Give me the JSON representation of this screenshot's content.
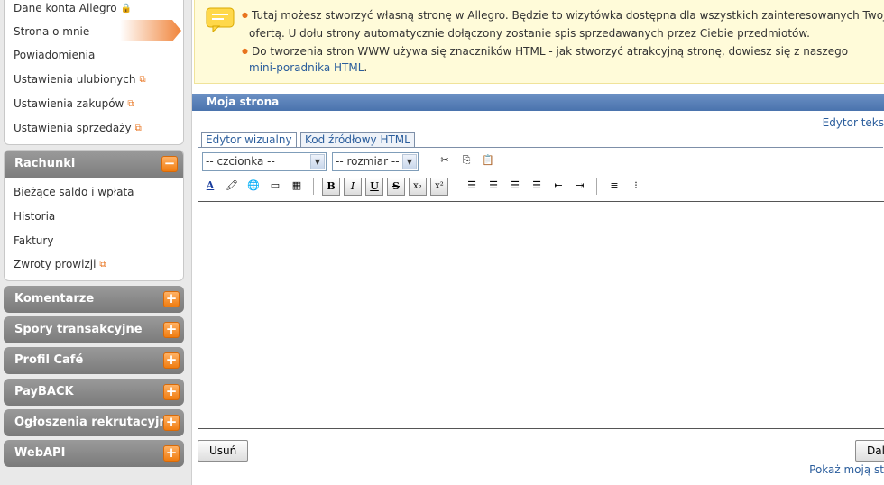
{
  "sidebar": {
    "account_items": [
      {
        "label": "Dane konta Allegro",
        "icon": "lock-icon"
      },
      {
        "label": "Strona o mnie",
        "active": true
      },
      {
        "label": "Powiadomienia"
      },
      {
        "label": "Ustawienia ulubionych",
        "icon": "external-link-icon"
      },
      {
        "label": "Ustawienia zakupów",
        "icon": "external-link-icon"
      },
      {
        "label": "Ustawienia sprzedaży",
        "icon": "external-link-icon"
      }
    ],
    "rachunki": {
      "title": "Rachunki",
      "toggle": "−",
      "items": [
        {
          "label": "Bieżące saldo i wpłata"
        },
        {
          "label": "Historia"
        },
        {
          "label": "Faktury"
        },
        {
          "label": "Zwroty prowizji",
          "icon": "external-link-icon"
        }
      ]
    },
    "collapsed": [
      {
        "title": "Komentarze",
        "toggle": "+"
      },
      {
        "title": "Spory transakcyjne",
        "toggle": "+"
      },
      {
        "title": "Profil Café",
        "toggle": "+"
      },
      {
        "title": "PayBACK",
        "toggle": "+"
      },
      {
        "title": "Ogłoszenia rekrutacyjne",
        "toggle": "+"
      },
      {
        "title": "WebAPI",
        "toggle": "+"
      }
    ]
  },
  "info": {
    "line1": "Tutaj możesz stworzyć własną stronę w Allegro. Będzie to wizytówka dostępna dla wszystkich zainteresowanych Twoją",
    "line2": "ofertą. U dołu strony automatycznie dołączony zostanie spis sprzedawanych przez Ciebie przedmiotów.",
    "line3": "Do tworzenia stron WWW używa się znaczników HTML - jak stworzyć atrakcyjną stronę, dowiesz się z naszego",
    "link": "mini-poradnika HTML",
    "link_suffix": "."
  },
  "section": {
    "title": "Moja strona",
    "editor_text_link": "Edytor teks"
  },
  "editor": {
    "tabs": [
      "Edytor wizualny",
      "Kod źródłowy HTML"
    ],
    "font_select": "-- czcionka --",
    "size_select": "-- rozmiar --",
    "content": ""
  },
  "buttons": {
    "delete": "Usuń",
    "next": "Dalej",
    "show_link": "Pokaż moją st"
  },
  "colors": {
    "accent": "#e8731e",
    "link": "#2a5d9c",
    "section_bar": "#5a80b8"
  }
}
